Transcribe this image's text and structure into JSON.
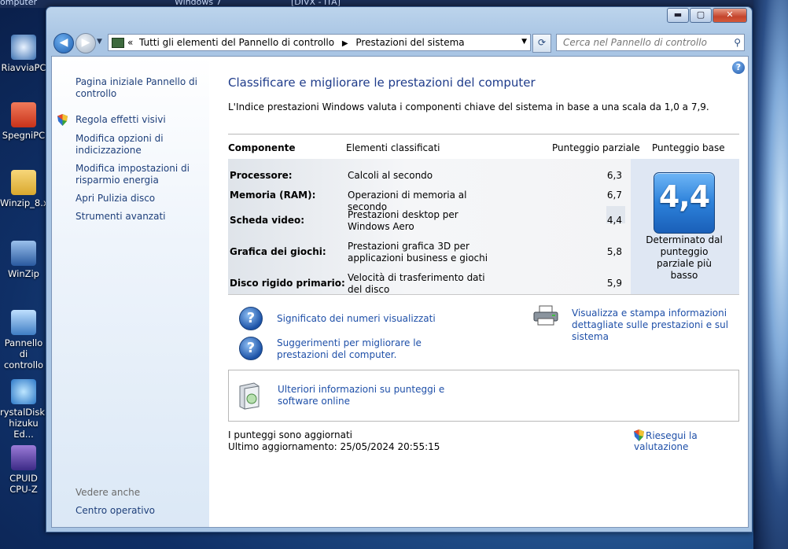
{
  "desktop": {
    "top_labels": [
      "omputer",
      "Windows 7",
      "[DIVX - ITA]"
    ],
    "icons": [
      "RiavviaPC",
      "SpegniPC",
      "Winzip_8.xx...",
      "WinZip",
      "Pannello di controllo",
      "rystalDisk... hizuku Ed...",
      "CPUID CPU-Z"
    ]
  },
  "window": {
    "buttons": {
      "minimize": "▬",
      "maximize": "▢",
      "close": "✕"
    },
    "address": {
      "prefix": "«",
      "crumb1": "Tutti gli elementi del Pannello di controllo",
      "crumb2": "Prestazioni del sistema"
    },
    "search_placeholder": "Cerca nel Pannello di controllo"
  },
  "sidebar": {
    "home": "Pagina iniziale Pannello di controllo",
    "links": [
      "Regola effetti visivi",
      "Modifica opzioni di indicizzazione",
      "Modifica impostazioni di risparmio energia",
      "Apri Pulizia disco",
      "Strumenti avanzati"
    ],
    "see_also": "Vedere anche",
    "action_center": "Centro operativo"
  },
  "main": {
    "title": "Classificare e migliorare le prestazioni del computer",
    "intro": "L'Indice prestazioni Windows valuta i componenti chiave del sistema in base a una scala da 1,0 a 7,9.",
    "headers": {
      "component": "Componente",
      "rated": "Elementi classificati",
      "subscore": "Punteggio parziale",
      "base": "Punteggio base"
    },
    "rows": [
      {
        "component": "Processore:",
        "rated": "Calcoli al secondo",
        "score": "6,3"
      },
      {
        "component": "Memoria (RAM):",
        "rated": "Operazioni di memoria al secondo",
        "score": "6,7"
      },
      {
        "component": "Scheda video:",
        "rated": "Prestazioni desktop per Windows Aero",
        "score": "4,4"
      },
      {
        "component": "Grafica dei giochi:",
        "rated": "Prestazioni grafica 3D per applicazioni business e giochi",
        "score": "5,8"
      },
      {
        "component": "Disco rigido primario:",
        "rated": "Velocità di trasferimento dati del disco",
        "score": "5,9"
      }
    ],
    "base_score": "4,4",
    "base_caption": "Determinato dal punteggio parziale più basso",
    "link_meaning": "Significato dei numeri visualizzati",
    "link_tips": "Suggerimenti per migliorare le prestazioni del computer.",
    "link_print": "Visualizza e stampa informazioni dettagliate sulle prestazioni e sul sistema",
    "link_online": "Ulteriori informazioni su punteggi e software online",
    "status_line1": "I punteggi sono aggiornati",
    "status_line2": "Ultimo aggiornamento: 25/05/2024 20:55:15",
    "rerun": "Riesegui la valutazione"
  },
  "colors": {
    "link": "#1e4fa8",
    "title": "#1e3b8a",
    "tile": "#2c81da"
  }
}
